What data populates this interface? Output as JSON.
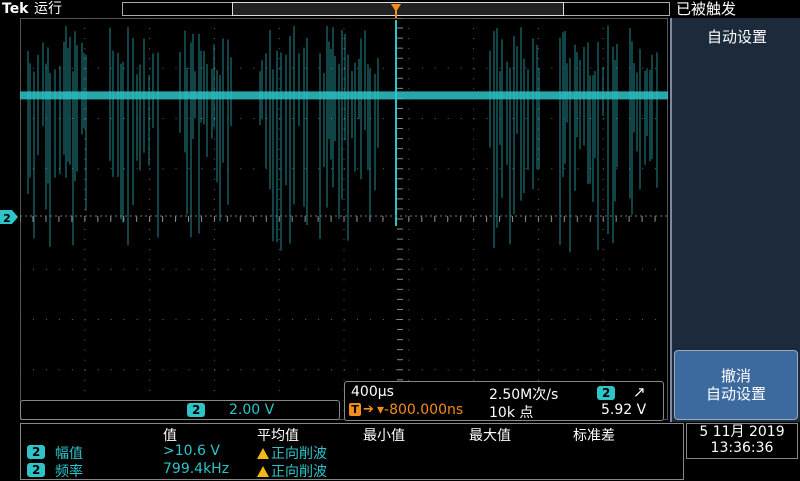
{
  "topbar": {
    "brand": "Tek",
    "run_state": "运行",
    "trigger_state": "已被触发",
    "trigger_marker": "T"
  },
  "side_menu": {
    "auto_setup": "自动设置",
    "undo_line1": "撤消",
    "undo_line2": "自动设置"
  },
  "channel": {
    "number": "2",
    "scale": "2.00 V"
  },
  "timebase": {
    "horizontal_scale": "400µs",
    "sample_rate": "2.50M次/s",
    "trigger_channel": "2",
    "trigger_slope": "↗",
    "delay": "▾-800.000ns",
    "record_length": "10k 点",
    "trigger_level": "5.92 V",
    "trigger_tag": "T"
  },
  "measurements": {
    "headers": [
      "值",
      "平均值",
      "最小值",
      "最大值",
      "标准差"
    ],
    "rows": [
      {
        "channel": "2",
        "name": "幅值",
        "value": ">10.6 V",
        "mean": "正向削波"
      },
      {
        "channel": "2",
        "name": "频率",
        "value": "799.4kHz",
        "mean": "正向削波"
      }
    ]
  },
  "datetime": {
    "date": "5 11月 2019",
    "time": "13:36:36"
  },
  "colors": {
    "trace": "#2ec4c8",
    "trigger": "#f28c1a",
    "side_menu_bg": "#1c2a3c",
    "undo_button": "#3c6a9e"
  },
  "waveform": {
    "description_free": true,
    "baseline_divisions_above_ground": 4.0,
    "ground_marker_channel": "2"
  }
}
